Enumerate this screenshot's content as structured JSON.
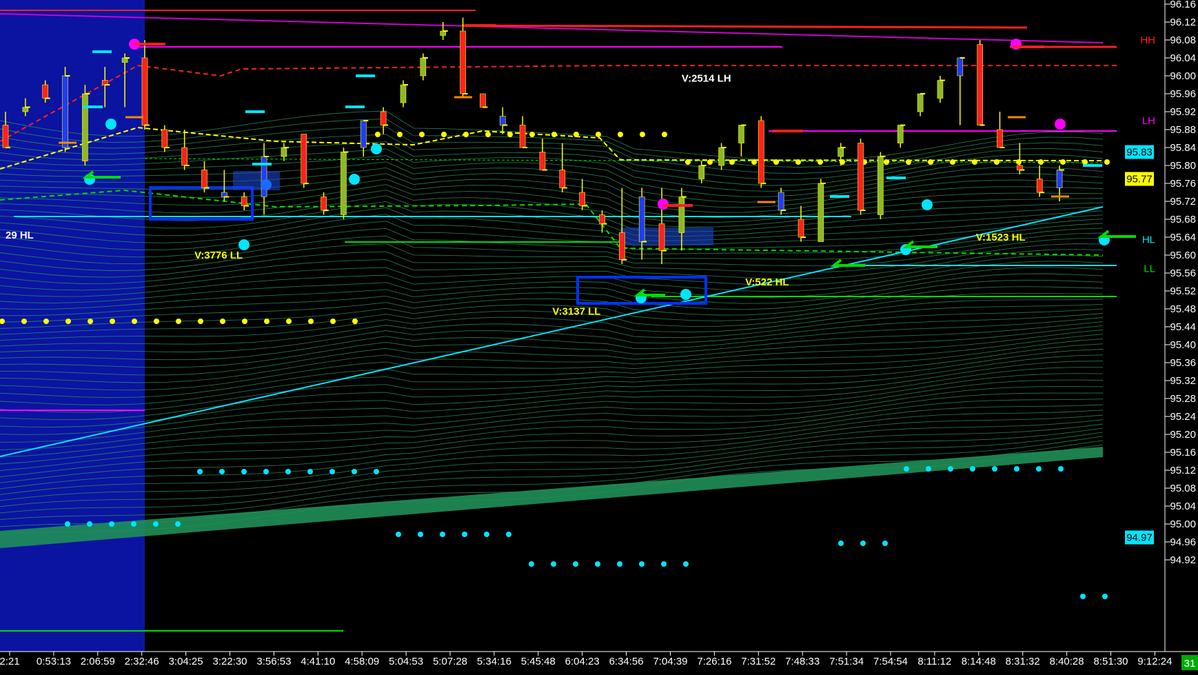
{
  "chart_data": {
    "type": "candlestick",
    "title": "",
    "ylim": [
      94.88,
      96.16
    ],
    "y_ticks": [
      "96.16",
      "96.12",
      "96.08",
      "96.04",
      "96.00",
      "95.96",
      "95.92",
      "95.88",
      "95.84",
      "95.80",
      "95.76",
      "95.72",
      "95.68",
      "95.64",
      "95.60",
      "95.56",
      "95.52",
      "95.48",
      "95.44",
      "95.40",
      "95.36",
      "95.32",
      "95.28",
      "95.24",
      "95.20",
      "95.16",
      "95.12",
      "95.08",
      "95.04",
      "95.00",
      "94.96",
      "94.92"
    ],
    "x_ticks": [
      "2:21",
      "0:53:13",
      "2:06:59",
      "2:32:46",
      "3:04:25",
      "3:22:30",
      "3:56:53",
      "4:41:10",
      "4:58:09",
      "5:04:53",
      "5:07:28",
      "5:34:16",
      "5:45:48",
      "6:04:23",
      "6:34:56",
      "7:04:39",
      "7:26:16",
      "7:31:52",
      "7:48:33",
      "7:51:34",
      "7:54:54",
      "8:11:12",
      "8:14:48",
      "8:31:32",
      "8:40:28",
      "8:51:30",
      "9:12:24"
    ],
    "price_badges": [
      {
        "value": "95.83",
        "color": "#00e5ff"
      },
      {
        "value": "95.77",
        "color": "#ffff00"
      },
      {
        "value": "94.97",
        "color": "#00e5ff"
      }
    ],
    "level_labels": [
      {
        "text": "HH",
        "value": 96.08,
        "color": "#ff2020"
      },
      {
        "text": "LH",
        "value": 95.9,
        "color": "#ff00ff"
      },
      {
        "text": "HL",
        "value": 95.635,
        "color": "#00e5ff"
      },
      {
        "text": "LL",
        "value": 95.57,
        "color": "#00dd00"
      }
    ],
    "annotations": [
      {
        "text": "29 HL",
        "x": 0,
        "y": 95.645,
        "color": "#ffffff"
      },
      {
        "text": "V:3776 LL",
        "x": 9.5,
        "y": 95.6,
        "color": "#ffff00"
      },
      {
        "text": "V:2514 LH",
        "x": 34,
        "y": 95.995,
        "color": "#ffffff"
      },
      {
        "text": "V:522 HL",
        "x": 37.2,
        "y": 95.54,
        "color": "#ffff00"
      },
      {
        "text": "V:3137 LL",
        "x": 27.5,
        "y": 95.475,
        "color": "#ffff00"
      },
      {
        "text": "V:1523 HL",
        "x": 48.8,
        "y": 95.64,
        "color": "#ffff00"
      }
    ],
    "candles": [
      [
        95.89,
        95.84,
        95.92,
        95.84
      ],
      [
        95.92,
        95.93,
        95.95,
        95.91
      ],
      [
        95.98,
        95.95,
        95.99,
        95.94
      ],
      [
        95.84,
        96.0,
        96.02,
        95.83
      ],
      [
        95.81,
        95.96,
        95.98,
        95.8
      ],
      [
        95.99,
        95.98,
        96.02,
        95.93
      ],
      [
        96.03,
        96.04,
        96.05,
        95.93
      ],
      [
        96.04,
        95.89,
        96.08,
        95.88
      ],
      [
        95.88,
        95.84,
        95.89,
        95.83
      ],
      [
        95.84,
        95.8,
        95.88,
        95.79
      ],
      [
        95.79,
        95.75,
        95.81,
        95.74
      ],
      [
        95.74,
        95.73,
        95.79,
        95.72
      ],
      [
        95.73,
        95.71,
        95.74,
        95.7
      ],
      [
        95.73,
        95.82,
        95.85,
        95.69
      ],
      [
        95.82,
        95.84,
        95.85,
        95.81
      ],
      [
        95.87,
        95.76,
        95.87,
        95.75
      ],
      [
        95.73,
        95.7,
        95.74,
        95.69
      ],
      [
        95.69,
        95.83,
        95.84,
        95.68
      ],
      [
        95.84,
        95.9,
        95.9,
        95.82
      ],
      [
        95.92,
        95.89,
        95.93,
        95.87
      ],
      [
        95.94,
        95.98,
        95.99,
        95.93
      ],
      [
        96.0,
        96.04,
        96.05,
        95.99
      ],
      [
        96.09,
        96.1,
        96.12,
        96.08
      ],
      [
        96.1,
        95.96,
        96.13,
        95.95
      ],
      [
        95.96,
        95.93,
        95.96,
        95.93
      ],
      [
        95.91,
        95.89,
        95.93,
        95.87
      ],
      [
        95.89,
        95.84,
        95.91,
        95.84
      ],
      [
        95.83,
        95.79,
        95.86,
        95.79
      ],
      [
        95.79,
        95.75,
        95.85,
        95.74
      ],
      [
        95.74,
        95.71,
        95.77,
        95.7
      ],
      [
        95.69,
        95.67,
        95.7,
        95.65
      ],
      [
        95.65,
        95.59,
        95.75,
        95.58
      ],
      [
        95.73,
        95.63,
        95.75,
        95.59
      ],
      [
        95.67,
        95.61,
        95.75,
        95.58
      ],
      [
        95.65,
        95.73,
        95.75,
        95.61
      ],
      [
        95.77,
        95.8,
        95.81,
        95.76
      ],
      [
        95.8,
        95.84,
        95.85,
        95.79
      ],
      [
        95.85,
        95.89,
        95.89,
        95.82
      ],
      [
        95.9,
        95.76,
        95.91,
        95.75
      ],
      [
        95.74,
        95.7,
        95.75,
        95.69
      ],
      [
        95.68,
        95.64,
        95.71,
        95.63
      ],
      [
        95.63,
        95.76,
        95.77,
        95.63
      ],
      [
        95.82,
        95.84,
        95.85,
        95.8
      ],
      [
        95.85,
        95.7,
        95.86,
        95.69
      ],
      [
        95.69,
        95.82,
        95.83,
        95.68
      ],
      [
        95.85,
        95.89,
        95.89,
        95.84
      ],
      [
        95.92,
        95.96,
        95.96,
        95.91
      ],
      [
        95.95,
        95.99,
        96.0,
        95.94
      ],
      [
        96.0,
        96.04,
        96.04,
        95.89
      ],
      [
        96.07,
        95.89,
        96.08,
        95.89
      ],
      [
        95.88,
        95.84,
        95.92,
        95.84
      ],
      [
        95.8,
        95.79,
        95.85,
        95.78
      ],
      [
        95.77,
        95.74,
        95.8,
        95.73
      ],
      [
        95.75,
        95.79,
        95.8,
        95.72
      ]
    ]
  }
}
